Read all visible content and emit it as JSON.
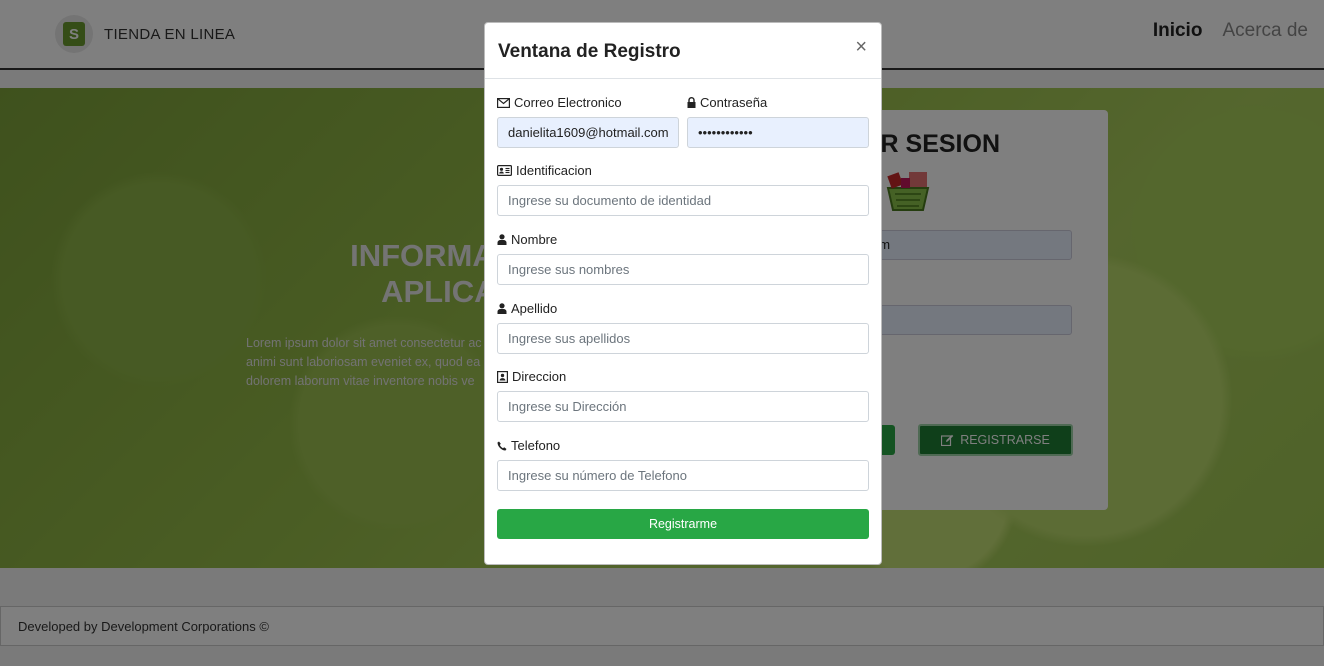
{
  "navbar": {
    "brand": "TIENDA EN LINEA",
    "links": [
      "Inicio",
      "Acerca de"
    ]
  },
  "hero": {
    "title_line1": "INFORMACIO",
    "title_line2": "APLICAC",
    "text_line1": "Lorem ipsum dolor sit amet consectetur ac",
    "text_line2": "animi sunt laboriosam eveniet ex, quod ea",
    "text_line3": "dolorem laborum vitae inventore nobis ve"
  },
  "login": {
    "title": "AR SESION",
    "email_value": "l.com",
    "register_button": "REGISTRARSE"
  },
  "footer": {
    "text": "Developed by Development Corporations ©"
  },
  "modal": {
    "title": "Ventana de Registro",
    "close": "×",
    "fields": {
      "email": {
        "label": "Correo Electronico",
        "value": "danielita1609@hotmail.com"
      },
      "password": {
        "label": "Contraseña",
        "value": "dddddddddddd"
      },
      "id": {
        "label": "Identificacion",
        "placeholder": "Ingrese su documento de identidad"
      },
      "name": {
        "label": "Nombre",
        "placeholder": "Ingrese sus nombres"
      },
      "lastname": {
        "label": "Apellido",
        "placeholder": "Ingrese sus apellidos"
      },
      "address": {
        "label": "Direccion",
        "placeholder": "Ingrese su Dirección"
      },
      "phone": {
        "label": "Telefono",
        "placeholder": "Ingrese su número de Telefono"
      }
    },
    "submit": "Registrarme"
  },
  "colors": {
    "accent_green": "#28a745",
    "dark_green": "#1e7e34",
    "autofill_blue": "#e8f0fe"
  }
}
